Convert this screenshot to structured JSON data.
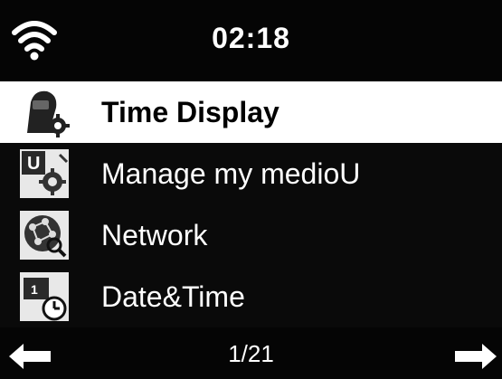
{
  "status_bar": {
    "time": "02:18",
    "wifi_icon": "wifi-icon"
  },
  "menu": {
    "items": [
      {
        "label": "Time Display",
        "icon": "time-display-icon",
        "selected": true
      },
      {
        "label": "Manage my medioU",
        "icon": "manage-mediou-icon",
        "selected": false
      },
      {
        "label": "Network",
        "icon": "network-icon",
        "selected": false
      },
      {
        "label": "Date&Time",
        "icon": "date-time-icon",
        "selected": false
      }
    ]
  },
  "footer": {
    "page_indicator": "1/21",
    "prev_icon": "arrow-left-icon",
    "next_icon": "arrow-right-icon"
  },
  "colors": {
    "background": "#000000",
    "text": "#ffffff",
    "selected_background": "#ffffff",
    "selected_text": "#000000"
  }
}
